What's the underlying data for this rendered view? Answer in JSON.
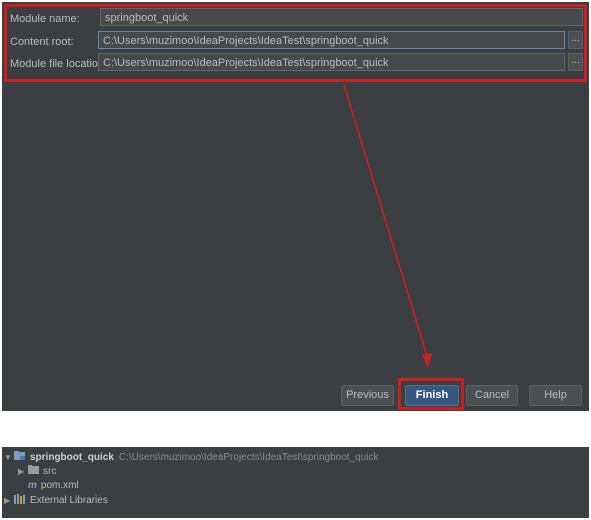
{
  "dialog": {
    "fields": [
      {
        "label": "Module name:",
        "value": "springboot_quick"
      },
      {
        "label": "Content root:",
        "value": "C:\\Users\\muzimoo\\IdeaProjects\\IdeaTest\\springboot_quick"
      },
      {
        "label": "Module file location:",
        "value": "C:\\Users\\muzimoo\\IdeaProjects\\IdeaTest\\springboot_quick"
      }
    ],
    "browse_label": "...",
    "buttons": {
      "previous": "Previous",
      "finish": "Finish",
      "cancel": "Cancel",
      "help": "Help"
    }
  },
  "project_tree": {
    "root": {
      "name": "springboot_quick",
      "path": "C:\\Users\\muzimoo\\IdeaProjects\\IdeaTest\\springboot_quick"
    },
    "children": [
      {
        "name": "src",
        "icon": "folder-icon"
      },
      {
        "name": "pom.xml",
        "icon": "maven-file-icon"
      }
    ],
    "external": {
      "name": "External Libraries",
      "icon": "libraries-icon"
    }
  },
  "colors": {
    "dialog_bg": "#3c3f41",
    "highlight_red": "#cc1f1f",
    "default_button": "#365880",
    "folder_blue": "#7a9ec4"
  }
}
